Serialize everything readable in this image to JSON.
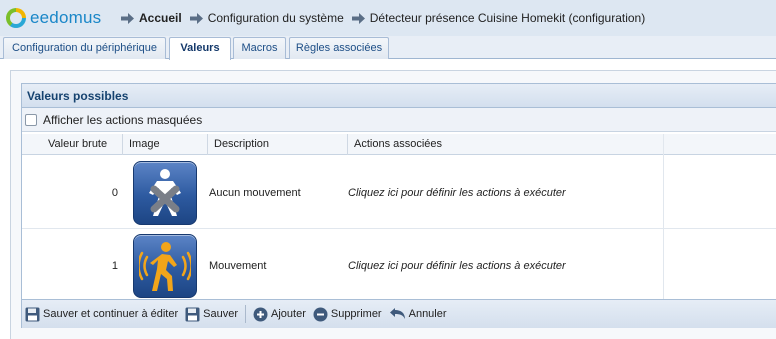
{
  "app": {
    "logo_text": "eedomus"
  },
  "breadcrumb": [
    {
      "label": "Accueil"
    },
    {
      "label": "Configuration du système"
    },
    {
      "label": "Détecteur présence Cuisine Homekit (configuration)"
    }
  ],
  "tabs": [
    {
      "label": "Configuration du périphérique",
      "active": false
    },
    {
      "label": "Valeurs",
      "active": true
    },
    {
      "label": "Macros",
      "active": false
    },
    {
      "label": "Règles associées",
      "active": false
    }
  ],
  "panel": {
    "title": "Valeurs possibles",
    "show_hidden_label": "Afficher les actions masquées",
    "show_hidden_checked": false
  },
  "table": {
    "columns": [
      "Valeur brute",
      "Image",
      "Description",
      "Actions associées"
    ],
    "rows": [
      {
        "raw": "0",
        "icon": "no-motion-person-icon",
        "description": "Aucun mouvement",
        "action": "Cliquez ici pour définir les actions à exécuter"
      },
      {
        "raw": "1",
        "icon": "motion-person-icon",
        "description": "Mouvement",
        "action": "Cliquez ici pour définir les actions à exécuter"
      }
    ]
  },
  "toolbar": {
    "save_continue": "Sauver et continuer à éditer",
    "save": "Sauver",
    "add": "Ajouter",
    "remove": "Supprimer",
    "cancel": "Annuler"
  },
  "colors": {
    "header_bg": "#dde7f2",
    "accent": "#1a87c8",
    "tile_blue": "#2d5aa0",
    "motion_yellow": "#f2a51a"
  }
}
